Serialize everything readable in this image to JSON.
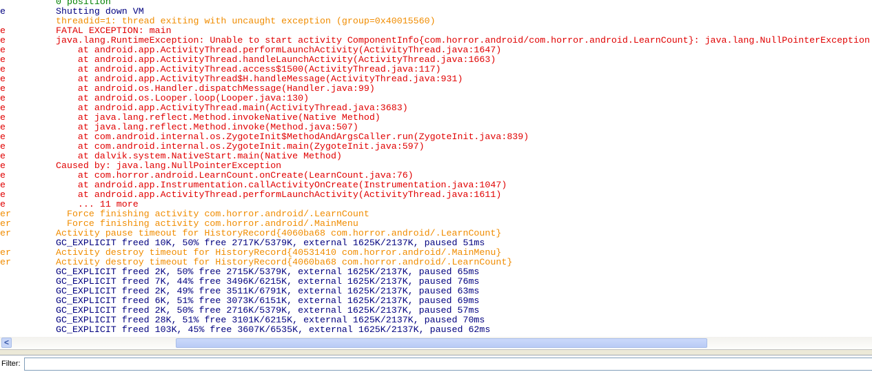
{
  "colors": {
    "verbose_info": "#008000",
    "debug": "#00007f",
    "warning": "#f08c00",
    "error": "#e00000"
  },
  "log": [
    {
      "tag": "",
      "level": "info",
      "text": "0 position"
    },
    {
      "tag": "e",
      "level": "debug",
      "text": "Shutting down VM"
    },
    {
      "tag": "",
      "level": "warning",
      "text": "threadid=1: thread exiting with uncaught exception (group=0x40015560)"
    },
    {
      "tag": "e",
      "level": "error",
      "text": "FATAL EXCEPTION: main"
    },
    {
      "tag": "e",
      "level": "error",
      "text": "java.lang.RuntimeException: Unable to start activity ComponentInfo{com.horror.android/com.horror.android.LearnCount}: java.lang.NullPointerException"
    },
    {
      "tag": "e",
      "level": "error",
      "text": "    at android.app.ActivityThread.performLaunchActivity(ActivityThread.java:1647)"
    },
    {
      "tag": "e",
      "level": "error",
      "text": "    at android.app.ActivityThread.handleLaunchActivity(ActivityThread.java:1663)"
    },
    {
      "tag": "e",
      "level": "error",
      "text": "    at android.app.ActivityThread.access$1500(ActivityThread.java:117)"
    },
    {
      "tag": "e",
      "level": "error",
      "text": "    at android.app.ActivityThread$H.handleMessage(ActivityThread.java:931)"
    },
    {
      "tag": "e",
      "level": "error",
      "text": "    at android.os.Handler.dispatchMessage(Handler.java:99)"
    },
    {
      "tag": "e",
      "level": "error",
      "text": "    at android.os.Looper.loop(Looper.java:130)"
    },
    {
      "tag": "e",
      "level": "error",
      "text": "    at android.app.ActivityThread.main(ActivityThread.java:3683)"
    },
    {
      "tag": "e",
      "level": "error",
      "text": "    at java.lang.reflect.Method.invokeNative(Native Method)"
    },
    {
      "tag": "e",
      "level": "error",
      "text": "    at java.lang.reflect.Method.invoke(Method.java:507)"
    },
    {
      "tag": "e",
      "level": "error",
      "text": "    at com.android.internal.os.ZygoteInit$MethodAndArgsCaller.run(ZygoteInit.java:839)"
    },
    {
      "tag": "e",
      "level": "error",
      "text": "    at com.android.internal.os.ZygoteInit.main(ZygoteInit.java:597)"
    },
    {
      "tag": "e",
      "level": "error",
      "text": "    at dalvik.system.NativeStart.main(Native Method)"
    },
    {
      "tag": "e",
      "level": "error",
      "text": "Caused by: java.lang.NullPointerException"
    },
    {
      "tag": "e",
      "level": "error",
      "text": "    at com.horror.android.LearnCount.onCreate(LearnCount.java:76)"
    },
    {
      "tag": "e",
      "level": "error",
      "text": "    at android.app.Instrumentation.callActivityOnCreate(Instrumentation.java:1047)"
    },
    {
      "tag": "e",
      "level": "error",
      "text": "    at android.app.ActivityThread.performLaunchActivity(ActivityThread.java:1611)"
    },
    {
      "tag": "e",
      "level": "error",
      "text": "    ... 11 more"
    },
    {
      "tag": "er",
      "level": "warning",
      "text": "  Force finishing activity com.horror.android/.LearnCount"
    },
    {
      "tag": "er",
      "level": "warning",
      "text": "  Force finishing activity com.horror.android/.MainMenu"
    },
    {
      "tag": "er",
      "level": "warning",
      "text": "Activity pause timeout for HistoryRecord{4060ba68 com.horror.android/.LearnCount}"
    },
    {
      "tag": "",
      "level": "debug",
      "text": "GC_EXPLICIT freed 10K, 50% free 2717K/5379K, external 1625K/2137K, paused 51ms"
    },
    {
      "tag": "er",
      "level": "warning",
      "text": "Activity destroy timeout for HistoryRecord{40531410 com.horror.android/.MainMenu}"
    },
    {
      "tag": "er",
      "level": "warning",
      "text": "Activity destroy timeout for HistoryRecord{4060ba68 com.horror.android/.LearnCount}"
    },
    {
      "tag": "",
      "level": "debug",
      "text": "GC_EXPLICIT freed 2K, 50% free 2715K/5379K, external 1625K/2137K, paused 65ms"
    },
    {
      "tag": "",
      "level": "debug",
      "text": "GC_EXPLICIT freed 7K, 44% free 3496K/6215K, external 1625K/2137K, paused 76ms"
    },
    {
      "tag": "",
      "level": "debug",
      "text": "GC_EXPLICIT freed 2K, 49% free 3511K/6791K, external 1625K/2137K, paused 63ms"
    },
    {
      "tag": "",
      "level": "debug",
      "text": "GC_EXPLICIT freed 6K, 51% free 3073K/6151K, external 1625K/2137K, paused 69ms"
    },
    {
      "tag": "",
      "level": "debug",
      "text": "GC_EXPLICIT freed 2K, 50% free 2716K/5379K, external 1625K/2137K, paused 57ms"
    },
    {
      "tag": "",
      "level": "debug",
      "text": "GC_EXPLICIT freed 28K, 51% free 3101K/6215K, external 1625K/2137K, paused 70ms"
    },
    {
      "tag": "",
      "level": "debug",
      "text": "GC_EXPLICIT freed 103K, 45% free 3607K/6535K, external 1625K/2137K, paused 62ms"
    }
  ],
  "scrollbar": {
    "left_arrow": "<"
  },
  "filter": {
    "label": "Filter:",
    "value": ""
  }
}
